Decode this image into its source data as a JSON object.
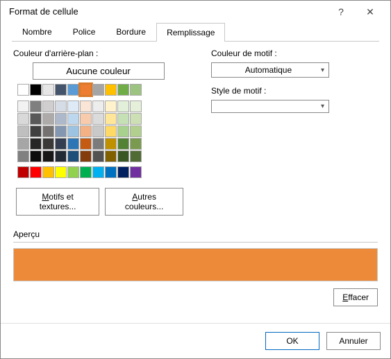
{
  "title": "Format de cellule",
  "help": "?",
  "close": "✕",
  "tabs": {
    "nombre": "Nombre",
    "police": "Police",
    "bordure": "Bordure",
    "remplissage": "Remplissage"
  },
  "labels": {
    "bg": "Couleur d'arrière-plan :",
    "pattern_color": "Couleur de motif :",
    "pattern_style": "Style de motif :",
    "preview": "Aperçu"
  },
  "buttons": {
    "no_color": "Aucune couleur",
    "fill_effects": "Motifs et textures...",
    "more_colors": "Autres couleurs...",
    "clear": "Effacer",
    "ok": "OK",
    "cancel": "Annuler"
  },
  "pattern_color_selected": "Automatique",
  "preview_color": "#ed8a3a",
  "theme_row": [
    "#ffffff",
    "#000000",
    "#e7e6e6",
    "#44546a",
    "#5b9bd5",
    "#ed7d31",
    "#a5a5a5",
    "#ffc000",
    "#70ad47",
    "#9cc37f"
  ],
  "selected_index": 5,
  "tints": [
    [
      "#f2f2f2",
      "#d9d9d9",
      "#bfbfbf",
      "#a6a6a6",
      "#808080"
    ],
    [
      "#7f7f7f",
      "#595959",
      "#404040",
      "#262626",
      "#0d0d0d"
    ],
    [
      "#d0cece",
      "#aeaaaa",
      "#767171",
      "#3b3838",
      "#181717"
    ],
    [
      "#d6dce5",
      "#adb9ca",
      "#8497b0",
      "#333f50",
      "#222a35"
    ],
    [
      "#deebf7",
      "#bdd7ee",
      "#9dc3e2",
      "#2e75b6",
      "#1f4e79"
    ],
    [
      "#fbe5d6",
      "#f8cbad",
      "#f4b183",
      "#c55a11",
      "#843c0c"
    ],
    [
      "#ededed",
      "#dbdbdb",
      "#c9c9c9",
      "#7b7b7b",
      "#525252"
    ],
    [
      "#fff2cc",
      "#ffe699",
      "#ffd966",
      "#bf9000",
      "#806000"
    ],
    [
      "#e2f0d9",
      "#c5e0b4",
      "#a9d18e",
      "#548235",
      "#385723"
    ],
    [
      "#e5efda",
      "#ccdfb5",
      "#b3cf90",
      "#7a9a50",
      "#516b35"
    ]
  ],
  "standard": [
    "#c00000",
    "#ff0000",
    "#ffc000",
    "#ffff00",
    "#92d050",
    "#00b050",
    "#00b0f0",
    "#0070c0",
    "#002060",
    "#7030a0"
  ]
}
